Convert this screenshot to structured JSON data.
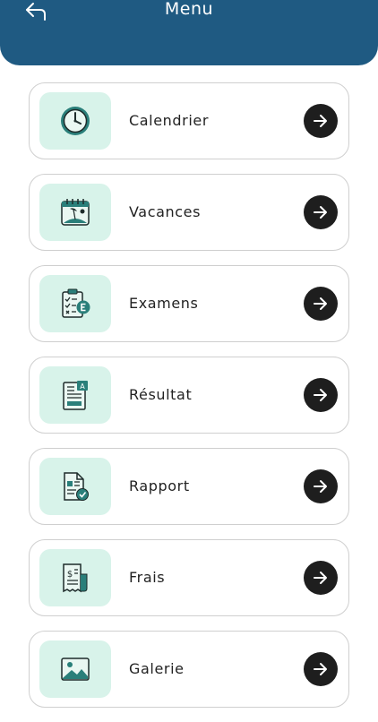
{
  "header": {
    "title": "Menu",
    "back_icon": "back-arrow-icon",
    "background": "#1f5a82"
  },
  "menu": {
    "items": [
      {
        "label": "Calendrier",
        "icon": "clock-icon"
      },
      {
        "label": "Vacances",
        "icon": "beach-calendar-icon"
      },
      {
        "label": "Examens",
        "icon": "exam-clipboard-icon"
      },
      {
        "label": "Résultat",
        "icon": "result-document-icon"
      },
      {
        "label": "Rapport",
        "icon": "report-document-icon"
      },
      {
        "label": "Frais",
        "icon": "fees-receipt-icon"
      },
      {
        "label": "Galerie",
        "icon": "gallery-image-icon"
      }
    ]
  },
  "colors": {
    "tile": "#d8f3ea",
    "accent": "#2a7f7a",
    "arrow_bg": "#1e1e1e"
  }
}
